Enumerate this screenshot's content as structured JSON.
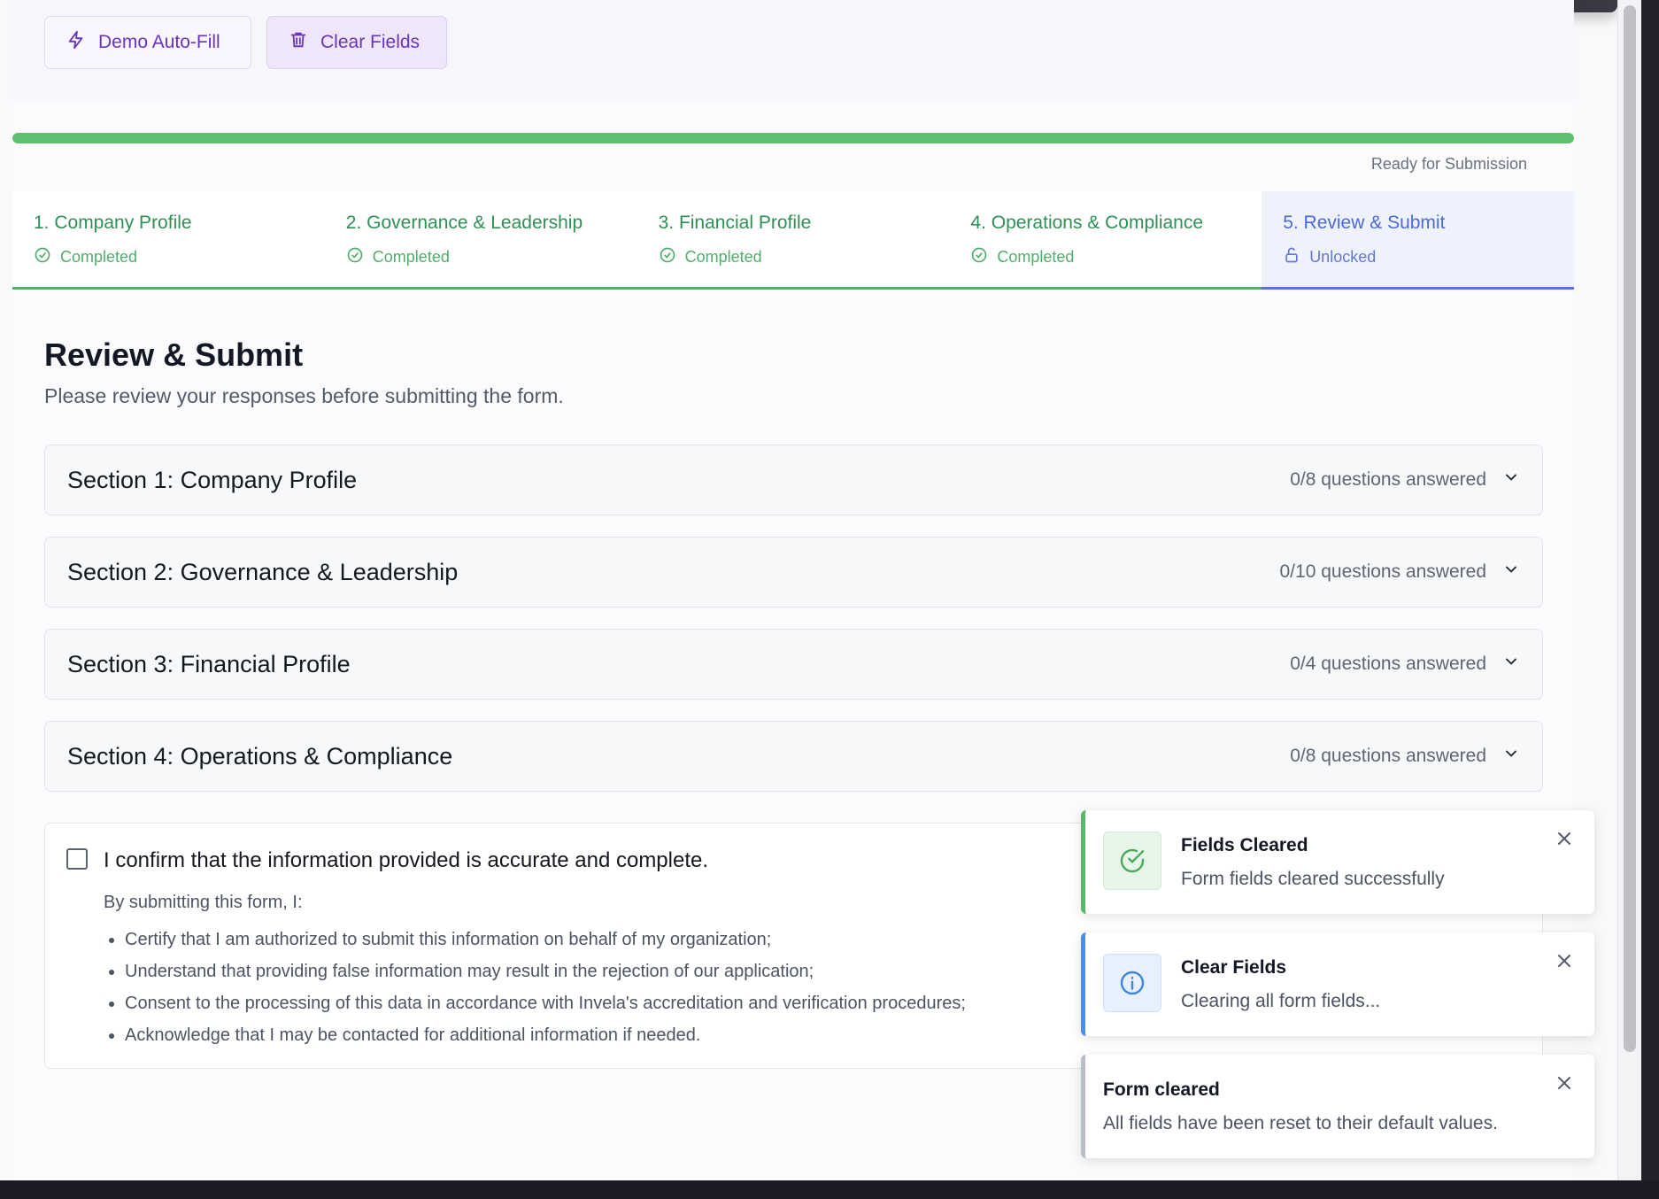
{
  "toolbar": {
    "demo_autofill_label": "Demo Auto-Fill",
    "clear_fields_label": "Clear Fields"
  },
  "progress": {
    "percent": 100,
    "status": "Ready for Submission",
    "color": "#5ec16f"
  },
  "steps": [
    {
      "title": "1. Company Profile",
      "status": "Completed",
      "icon": "check-circle-icon"
    },
    {
      "title": "2. Governance & Leadership",
      "status": "Completed",
      "icon": "check-circle-icon"
    },
    {
      "title": "3. Financial Profile",
      "status": "Completed",
      "icon": "check-circle-icon"
    },
    {
      "title": "4. Operations & Compliance",
      "status": "Completed",
      "icon": "check-circle-icon"
    },
    {
      "title": "5. Review & Submit",
      "status": "Unlocked",
      "icon": "unlock-icon"
    }
  ],
  "review": {
    "title": "Review & Submit",
    "description": "Please review your responses before submitting the form.",
    "sections": [
      {
        "title": "Section 1: Company Profile",
        "answered": "0/8 questions answered"
      },
      {
        "title": "Section 2: Governance & Leadership",
        "answered": "0/10 questions answered"
      },
      {
        "title": "Section 3: Financial Profile",
        "answered": "0/4 questions answered"
      },
      {
        "title": "Section 4: Operations & Compliance",
        "answered": "0/8 questions answered"
      }
    ]
  },
  "confirmation": {
    "checked": false,
    "label": "I confirm that the information provided is accurate and complete.",
    "intro": "By submitting this form, I:",
    "items": [
      "Certify that I am authorized to submit this information on behalf of my organization;",
      "Understand that providing false information may result in the rejection of our application;",
      "Consent to the processing of this data in accordance with Invela's accreditation and verification procedures;",
      "Acknowledge that I may be contacted for additional information if needed."
    ]
  },
  "toasts": [
    {
      "type": "success",
      "icon": "check-circle-icon",
      "title": "Fields Cleared",
      "message": "Form fields cleared successfully"
    },
    {
      "type": "info",
      "icon": "info-icon",
      "title": "Clear Fields",
      "message": "Clearing all form fields..."
    },
    {
      "type": "plain",
      "title": "Form cleared",
      "message": "All fields have been reset to their default values."
    }
  ],
  "colors": {
    "accent_purple": "#6a35b8",
    "success_green": "#4fb06a",
    "active_blue": "#5d6fd8",
    "info_blue": "#4e8fe3"
  }
}
